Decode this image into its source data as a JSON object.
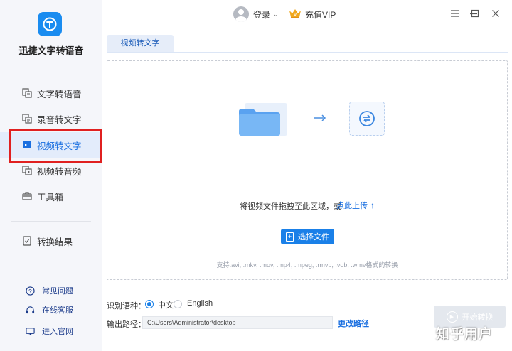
{
  "app": {
    "name": "迅捷文字转语音",
    "accent": "#1a80e8"
  },
  "sidebar": {
    "items": [
      {
        "label": "文字转语音",
        "icon": "text-to-speech-icon"
      },
      {
        "label": "录音转文字",
        "icon": "recording-icon"
      },
      {
        "label": "视频转文字",
        "icon": "video-icon"
      },
      {
        "label": "视频转音频",
        "icon": "video-audio-icon"
      },
      {
        "label": "工具箱",
        "icon": "toolbox-icon"
      },
      {
        "label": "转换结果",
        "icon": "result-icon"
      }
    ],
    "active_index": 2,
    "bottom_links": [
      {
        "label": "常见问题",
        "icon": "help-icon"
      },
      {
        "label": "在线客服",
        "icon": "headset-icon"
      },
      {
        "label": "进入官网",
        "icon": "website-icon"
      }
    ]
  },
  "topbar": {
    "login_label": "登录",
    "vip_label": "充值VIP"
  },
  "tab": {
    "label": "视频转文字"
  },
  "dropzone": {
    "hint": "将视频文件拖拽至此区域，或",
    "upload_link": "点此上传",
    "select_button": "选择文件",
    "formats": "支持.avi, .mkv, .mov, .mp4, .mpeg, .rmvb, .vob, .wmv格式的转换"
  },
  "settings": {
    "language_label": "识别语种：",
    "languages": [
      "中文",
      "English"
    ],
    "selected_language": "中文",
    "path_label": "输出路径：",
    "path_value": "C:\\Users\\Administrator\\desktop",
    "change_path": "更改路径"
  },
  "start_button": "开始转换",
  "watermark": "知乎用户"
}
